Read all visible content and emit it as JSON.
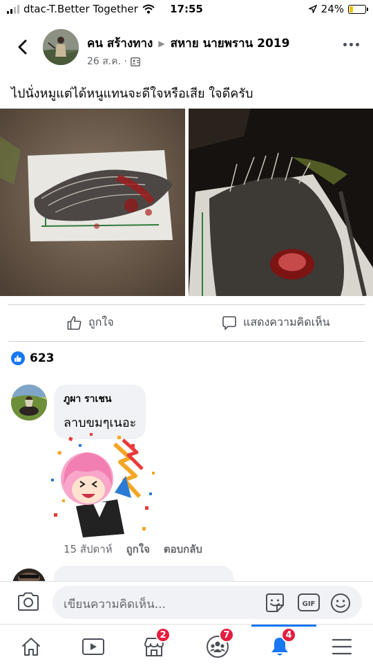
{
  "status_bar": {
    "carrier": "dtac-T.Better Together",
    "time": "17:55",
    "battery": "24%",
    "battery_level": 0.24
  },
  "post": {
    "author": "คน สร้างทาง",
    "group": "สหาย นายพราน 2019",
    "date": "26 ส.ค. ·",
    "privacy_icon": "group-icon",
    "text": "ไปนั่งหมูแต่ได้หนูแทนจะดีใจหรือเสีย ใจดีครับ",
    "photos": [
      {
        "icon": "porcupine-photo"
      },
      {
        "icon": "porcupine-closeup-photo"
      }
    ]
  },
  "actions": {
    "like_label": "ถูกใจ",
    "comment_label": "แสดงความคิดเห็น"
  },
  "reactions": {
    "count": "623",
    "color": "#1877f2"
  },
  "comments": [
    {
      "name": "ภูผา ราเชน",
      "text": "ลาบขมๆเนอะ",
      "time": "15 สัปดาห์",
      "like_label": "ถูกใจ",
      "reply_label": "ตอบกลับ",
      "sticker": "celebration-girl-sticker"
    }
  ],
  "composer": {
    "placeholder": "เขียนความคิดเห็น..."
  },
  "tabbar": {
    "tabs": [
      {
        "icon": "home-icon",
        "badge": ""
      },
      {
        "icon": "video-icon",
        "badge": ""
      },
      {
        "icon": "marketplace-icon",
        "badge": "2"
      },
      {
        "icon": "groups-icon",
        "badge": "7"
      },
      {
        "icon": "bell-icon",
        "badge": "4"
      },
      {
        "icon": "menu-icon",
        "badge": ""
      }
    ],
    "active_color": "#1877f2"
  }
}
